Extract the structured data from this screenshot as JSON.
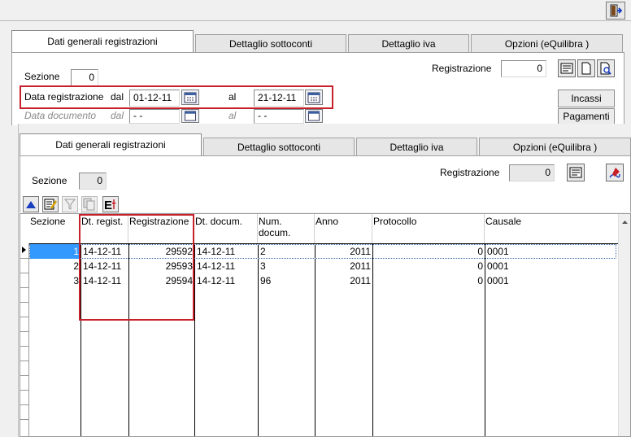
{
  "top": {
    "tabs": [
      "Dati generali registrazioni",
      "Dettaglio sottoconti",
      "Dettaglio iva",
      "Opzioni (eQuilibra )"
    ],
    "sezione_label": "Sezione",
    "sezione_value": "0",
    "registrazione_label": "Registrazione",
    "registrazione_value": "0",
    "data_reg_label": "Data registrazione",
    "dal_label": "dal",
    "al_label": "al",
    "data_dal": "01-12-11",
    "data_al": "21-12-11",
    "data_doc_label": "Data documento",
    "doc_dal": "- -",
    "doc_al": "- -",
    "incassi": "Incassi",
    "pagamenti": "Pagamenti"
  },
  "bottom": {
    "tabs": [
      "Dati generali registrazioni",
      "Dettaglio sottoconti",
      "Dettaglio iva",
      "Opzioni (eQuilibra )"
    ],
    "sezione_label": "Sezione",
    "sezione_value": "0",
    "registrazione_label": "Registrazione",
    "registrazione_value": "0"
  },
  "grid": {
    "headers": [
      "Sezione",
      "Dt. regist.",
      "Registrazione",
      "Dt. docum.",
      "Num. docum.",
      "Anno",
      "Protocollo",
      "Causale"
    ],
    "rows": [
      [
        "1",
        "14-12-11",
        "29592",
        "14-12-11",
        "2",
        "2011",
        "0",
        "0001"
      ],
      [
        "2",
        "14-12-11",
        "29593",
        "14-12-11",
        "3",
        "2011",
        "0",
        "0001"
      ],
      [
        "3",
        "14-12-11",
        "29594",
        "14-12-11",
        "96",
        "2011",
        "0",
        "0001"
      ]
    ]
  },
  "colors": {
    "highlight": "#c8202a",
    "selection": "#3399ff"
  }
}
